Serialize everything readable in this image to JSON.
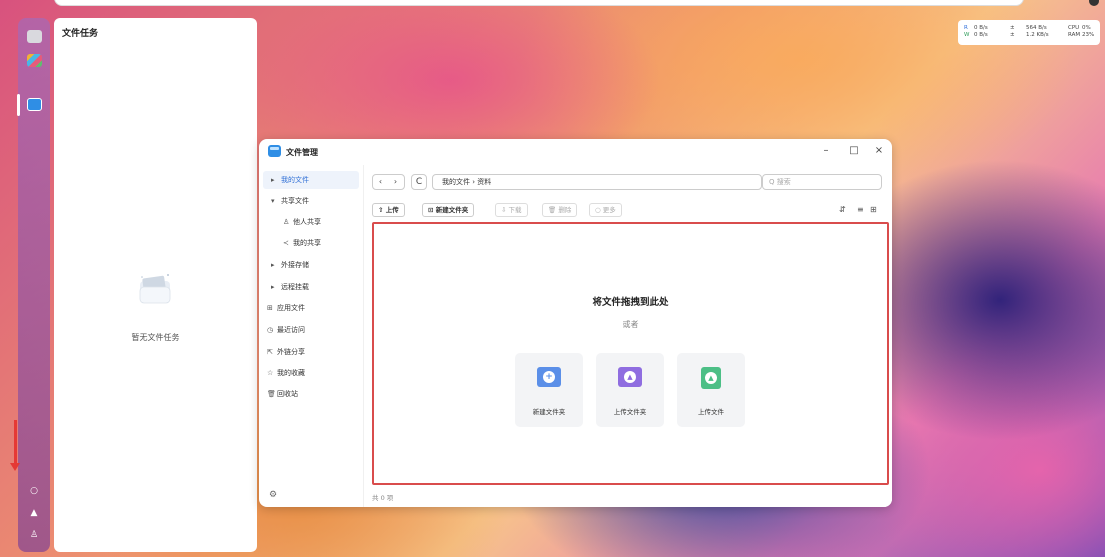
{
  "task_panel": {
    "title": "文件任务",
    "empty_text": "暂无文件任务"
  },
  "net_monitor": {
    "rows": [
      {
        "dir": "R",
        "speed": "0  B/s",
        "arrow": "±",
        "rate": "564  B/s",
        "metric": "CPU",
        "pct": "0%"
      },
      {
        "dir": "W",
        "speed": "0  B/s",
        "arrow": "±",
        "rate": "1.2 KB/s",
        "metric": "RAM",
        "pct": "23%"
      }
    ]
  },
  "file_manager": {
    "title": "文件管理",
    "window_buttons": {
      "minimize": "–",
      "maximize": "□",
      "close": "×"
    },
    "sidebar": {
      "items": [
        {
          "icon": "▸",
          "label": "我的文件"
        },
        {
          "icon": "▾",
          "label": "共享文件"
        },
        {
          "icon": "♙",
          "label": "他人共享"
        },
        {
          "icon": "≺",
          "label": "我的共享"
        },
        {
          "icon": "▸",
          "label": "外接存储"
        },
        {
          "icon": "▸",
          "label": "远程挂载"
        },
        {
          "icon": "⊞",
          "label": "应用文件"
        },
        {
          "icon": "◷",
          "label": "最近访问"
        },
        {
          "icon": "⇱",
          "label": "外链分享"
        },
        {
          "icon": "☆",
          "label": "我的收藏"
        },
        {
          "icon": "🗑",
          "label": "回收站"
        }
      ],
      "settings_icon": "⚙"
    },
    "nav": {
      "back": "‹",
      "forward": "›",
      "refresh": "C"
    },
    "breadcrumb": "我的文件 › 资料",
    "search_placeholder": "Q 搜索",
    "toolbar": {
      "upload": "⇧ 上传",
      "new_folder": "⊡ 新建文件夹",
      "download": "⇩ 下载",
      "delete": "🗑 删除",
      "more": "○ 更多",
      "sort_icon": "⇵",
      "view_list": "≡",
      "view_grid": "⊞"
    },
    "dropzone": {
      "title": "将文件拖拽到此处",
      "or": "或者",
      "cards": [
        {
          "label": "新建文件夹",
          "glyph": "+",
          "color": "#5b8fe8"
        },
        {
          "label": "上传文件夹",
          "glyph": "▲",
          "color": "#8f6de0"
        },
        {
          "label": "上传文件",
          "glyph": "▲",
          "color": "#4cbf86"
        }
      ]
    },
    "footer": "共 0 项"
  },
  "dock": {
    "bottom_icons": [
      "○",
      "▲",
      "♙"
    ]
  }
}
